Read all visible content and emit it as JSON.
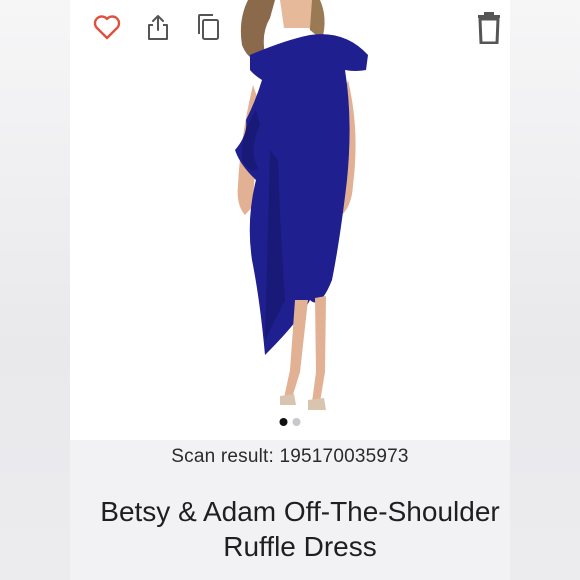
{
  "toolbar": {
    "favorite_icon": "heart-icon",
    "share_icon": "share-icon",
    "copy_icon": "copy-icon",
    "delete_icon": "trash-icon"
  },
  "colors": {
    "dress": "#1f1f8f",
    "heart": "#e0503e",
    "icon": "#555555"
  },
  "carousel": {
    "total": 2,
    "active": 1
  },
  "scan": {
    "text": "Scan result: 195170035973"
  },
  "product": {
    "title": "Betsy & Adam Off-The-Shoulder Ruffle Dress"
  }
}
